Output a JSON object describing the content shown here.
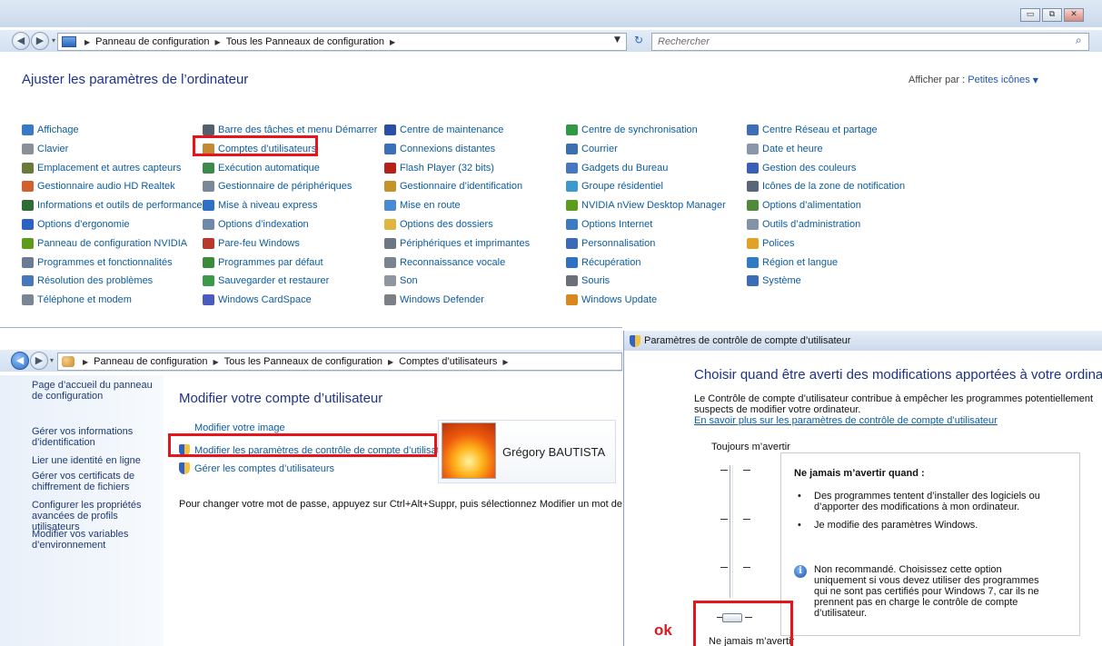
{
  "top": {
    "window_buttons": [
      "▭",
      "⧉",
      "✕"
    ],
    "breadcrumb": [
      "Panneau de configuration",
      "Tous les Panneaux de configuration"
    ],
    "search_placeholder": "Rechercher",
    "heading": "Ajuster les paramètres de l’ordinateur",
    "view_by_label": "Afficher par :",
    "view_by_value": "Petites icônes",
    "columns": [
      [
        {
          "label": "Affichage",
          "icon": "display-icon",
          "color": "#3a78c8"
        },
        {
          "label": "Clavier",
          "icon": "keyboard-icon",
          "color": "#8a8f98"
        },
        {
          "label": "Emplacement et autres capteurs",
          "icon": "location-sensor-icon",
          "color": "#6b7a3a"
        },
        {
          "label": "Gestionnaire audio HD Realtek",
          "icon": "realtek-audio-icon",
          "color": "#d0612c"
        },
        {
          "label": "Informations et outils de performance",
          "icon": "performance-icon",
          "color": "#2f6b34"
        },
        {
          "label": "Options d’ergonomie",
          "icon": "ergonomics-icon",
          "color": "#2d62c4"
        },
        {
          "label": "Panneau de configuration NVIDIA",
          "icon": "nvidia-icon",
          "color": "#5c9b1c"
        },
        {
          "label": "Programmes et fonctionnalités",
          "icon": "programs-icon",
          "color": "#6a7b94"
        },
        {
          "label": "Résolution des problèmes",
          "icon": "troubleshoot-icon",
          "color": "#4677b8"
        },
        {
          "label": "Téléphone et modem",
          "icon": "phone-modem-icon",
          "color": "#7b8694"
        }
      ],
      [
        {
          "label": "Barre des tâches et menu Démarrer",
          "icon": "taskbar-icon",
          "color": "#55606e"
        },
        {
          "label": "Comptes d’utilisateurs",
          "icon": "user-accounts-icon",
          "color": "#c48a33"
        },
        {
          "label": "Exécution automatique",
          "icon": "autoplay-icon",
          "color": "#3c8a4a"
        },
        {
          "label": "Gestionnaire de périphériques",
          "icon": "device-manager-icon",
          "color": "#7a8797"
        },
        {
          "label": "Mise à niveau express",
          "icon": "upgrade-icon",
          "color": "#2f6fc4"
        },
        {
          "label": "Options d’indexation",
          "icon": "indexing-icon",
          "color": "#6f89ad"
        },
        {
          "label": "Pare-feu Windows",
          "icon": "firewall-icon",
          "color": "#b8392a"
        },
        {
          "label": "Programmes par défaut",
          "icon": "default-programs-icon",
          "color": "#3a8c3a"
        },
        {
          "label": "Sauvegarder et restaurer",
          "icon": "backup-icon",
          "color": "#3a9a4a"
        },
        {
          "label": "Windows CardSpace",
          "icon": "cardspace-icon",
          "color": "#4a5bbd"
        }
      ],
      [
        {
          "label": "Centre de maintenance",
          "icon": "action-center-icon",
          "color": "#2a4fa8"
        },
        {
          "label": "Connexions distantes",
          "icon": "remote-connections-icon",
          "color": "#3a70b8"
        },
        {
          "label": "Flash Player (32 bits)",
          "icon": "flash-player-icon",
          "color": "#b8211a"
        },
        {
          "label": "Gestionnaire d’identification",
          "icon": "credential-manager-icon",
          "color": "#c4942a"
        },
        {
          "label": "Mise en route",
          "icon": "getting-started-icon",
          "color": "#4a8ad0"
        },
        {
          "label": "Options des dossiers",
          "icon": "folder-options-icon",
          "color": "#e0b640"
        },
        {
          "label": "Périphériques et imprimantes",
          "icon": "printer-icon",
          "color": "#6d7684"
        },
        {
          "label": "Reconnaissance vocale",
          "icon": "microphone-icon",
          "color": "#7a8390"
        },
        {
          "label": "Son",
          "icon": "speaker-icon",
          "color": "#8f96a0"
        },
        {
          "label": "Windows Defender",
          "icon": "defender-icon",
          "color": "#7b7f86"
        }
      ],
      [
        {
          "label": "Centre de synchronisation",
          "icon": "sync-center-icon",
          "color": "#2f9a45"
        },
        {
          "label": "Courrier",
          "icon": "mail-icon",
          "color": "#3b6fb0"
        },
        {
          "label": "Gadgets du Bureau",
          "icon": "gadgets-icon",
          "color": "#4677c0"
        },
        {
          "label": "Groupe résidentiel",
          "icon": "homegroup-icon",
          "color": "#3a9ad0"
        },
        {
          "label": "NVIDIA nView Desktop Manager",
          "icon": "nview-icon",
          "color": "#5c9b1c"
        },
        {
          "label": "Options Internet",
          "icon": "internet-options-icon",
          "color": "#3a7bc4"
        },
        {
          "label": "Personnalisation",
          "icon": "personalization-icon",
          "color": "#3b6bb8"
        },
        {
          "label": "Récupération",
          "icon": "recovery-icon",
          "color": "#2f6fc4"
        },
        {
          "label": "Souris",
          "icon": "mouse-icon",
          "color": "#6a6f78"
        },
        {
          "label": "Windows Update",
          "icon": "windows-update-icon",
          "color": "#d8881f"
        }
      ],
      [
        {
          "label": "Centre Réseau et partage",
          "icon": "network-icon",
          "color": "#3c6fb5"
        },
        {
          "label": "Date et heure",
          "icon": "clock-icon",
          "color": "#8a97a8"
        },
        {
          "label": "Gestion des couleurs",
          "icon": "color-management-icon",
          "color": "#3a5fb8"
        },
        {
          "label": "Icônes de la zone de notification",
          "icon": "notification-area-icon",
          "color": "#5a6675"
        },
        {
          "label": "Options d’alimentation",
          "icon": "power-icon",
          "color": "#4f8a3a"
        },
        {
          "label": "Outils d’administration",
          "icon": "admin-tools-icon",
          "color": "#8392a6"
        },
        {
          "label": "Polices",
          "icon": "fonts-icon",
          "color": "#e0a325"
        },
        {
          "label": "Région et langue",
          "icon": "region-icon",
          "color": "#2f7bc4"
        },
        {
          "label": "Système",
          "icon": "system-icon",
          "color": "#3a6cb8"
        }
      ]
    ]
  },
  "user_accounts": {
    "breadcrumb": [
      "Panneau de configuration",
      "Tous les Panneaux de configuration",
      "Comptes d’utilisateurs"
    ],
    "sidebar": [
      "Page d’accueil du panneau de configuration",
      "Gérer vos informations d’identification",
      "Lier une identité en ligne",
      "Gérer vos certificats de chiffrement de fichiers",
      "Configurer les propriétés avancées de profils utilisateurs",
      "Modifier vos variables d’environnement"
    ],
    "title": "Modifier votre compte d’utilisateur",
    "links": [
      "Modifier votre image",
      "Modifier les paramètres de contrôle de compte d’utilisateur",
      "Gérer les comptes d’utilisateurs"
    ],
    "password_note": "Pour changer votre mot de passe, appuyez sur Ctrl+Alt+Suppr, puis sélectionnez Modifier un mot de passe.",
    "user_name": "Grégory BAUTISTA"
  },
  "uac": {
    "title": "Paramètres de contrôle de compte d’utilisateur",
    "heading": "Choisir quand être averti des modifications apportées à votre ordinateur",
    "description": "Le Contrôle de compte d’utilisateur contribue à empêcher les programmes potentiellement suspects de modifier votre ordinateur.",
    "learn_more": "En savoir plus sur les paramètres de contrôle de compte d’utilisateur",
    "slider_top": "Toujours m’avertir",
    "slider_bottom": "Ne jamais m’avertir",
    "slider_level": 0,
    "box_title": "Ne jamais m’avertir quand :",
    "bullets": [
      "Des programmes tentent d’installer des logiciels ou d’apporter des modifications à mon ordinateur.",
      "Je modifie des paramètres Windows."
    ],
    "note": "Non recommandé. Choisissez cette option uniquement si vous devez utiliser des programmes qui ne sont pas certifiés pour Windows 7, car ils ne prennent pas en charge le contrôle de compte d’utilisateur.",
    "ok_annotation": "ok"
  }
}
